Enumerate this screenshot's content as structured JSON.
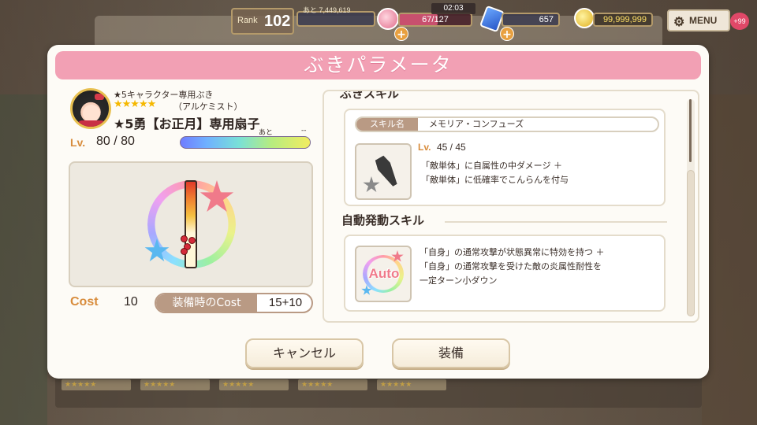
{
  "hud": {
    "rank_label": "Rank",
    "rank_value": "102",
    "exp_remaining": "あと 7,449,619",
    "stamina": "67/127",
    "stamina_progress": 0.53,
    "timer": "02:03",
    "gems": "657",
    "coins": "99,999,999",
    "menu_label": "MENU",
    "menu_badge": "+99",
    "plus_symbol": "+"
  },
  "dialog": {
    "title": "ぶきパラメータ",
    "weapon": {
      "subtitle": "★5キャラクター専用ぶき",
      "stars": "★★★★★",
      "class": "（アルケミスト）",
      "name": "★5勇【お正月】専用扇子",
      "level_label": "Lv.",
      "level": "80 / 80",
      "exp_next_label": "あと",
      "exp_next_value": "--",
      "cost_label": "Cost",
      "cost_value": "10",
      "equip_cost_label": "装備時のCost",
      "equip_cost_value": "15+10"
    },
    "skills": {
      "cut_heading": "ぶきスキル",
      "skill_tag_label": "スキル名",
      "skill_name": "メモリア・コンフューズ",
      "skill_level_label": "Lv.",
      "skill_level": "45 / 45",
      "skill_desc_line1": "「敵単体」に自属性の中ダメージ ＋",
      "skill_desc_line2": "「敵単体」に低確率でこんらんを付与",
      "auto_heading": "自動発動スキル",
      "auto_icon_text": "Auto",
      "auto_desc_line1": "「自身」の通常攻撃が状態異常に特効を持つ ＋",
      "auto_desc_line2": "「自身」の通常攻撃を受けた敵の炎属性耐性を",
      "auto_desc_line3": "一定ターン小ダウン"
    },
    "buttons": {
      "cancel": "キャンセル",
      "equip": "装備"
    }
  },
  "colors": {
    "title_bar": "#f2a0b4",
    "accent_orange": "#d88c3c",
    "tag_brown": "#b99a84",
    "panel_bg": "#fdfbf6"
  },
  "background_cards": [
    "★★★★★",
    "★★★★★",
    "★★★★★",
    "★★★★★",
    "★★★★★"
  ]
}
